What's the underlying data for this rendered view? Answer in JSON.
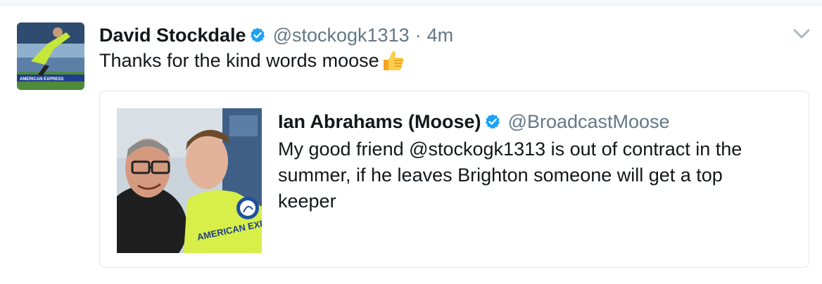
{
  "tweet": {
    "author_name": "David Stockdale",
    "handle": "@stockogk1313",
    "separator": "·",
    "time": "4m",
    "text": "Thanks for the kind words moose",
    "emoji": "thumbs-up",
    "avatar_caption": "AMERICAN EXPRESS"
  },
  "quoted": {
    "author_name": "Ian Abrahams (Moose)",
    "handle": "@BroadcastMoose",
    "text": "My good friend @stockogk1313 is out of contract in the summer, if he leaves Brighton someone will get a top keeper",
    "photo_caption": "AMERICAN EXPRESS"
  },
  "colors": {
    "verified_blue": "#1da1f2",
    "text": "#14171a",
    "muted": "#657786",
    "border": "#e1e8ed"
  }
}
